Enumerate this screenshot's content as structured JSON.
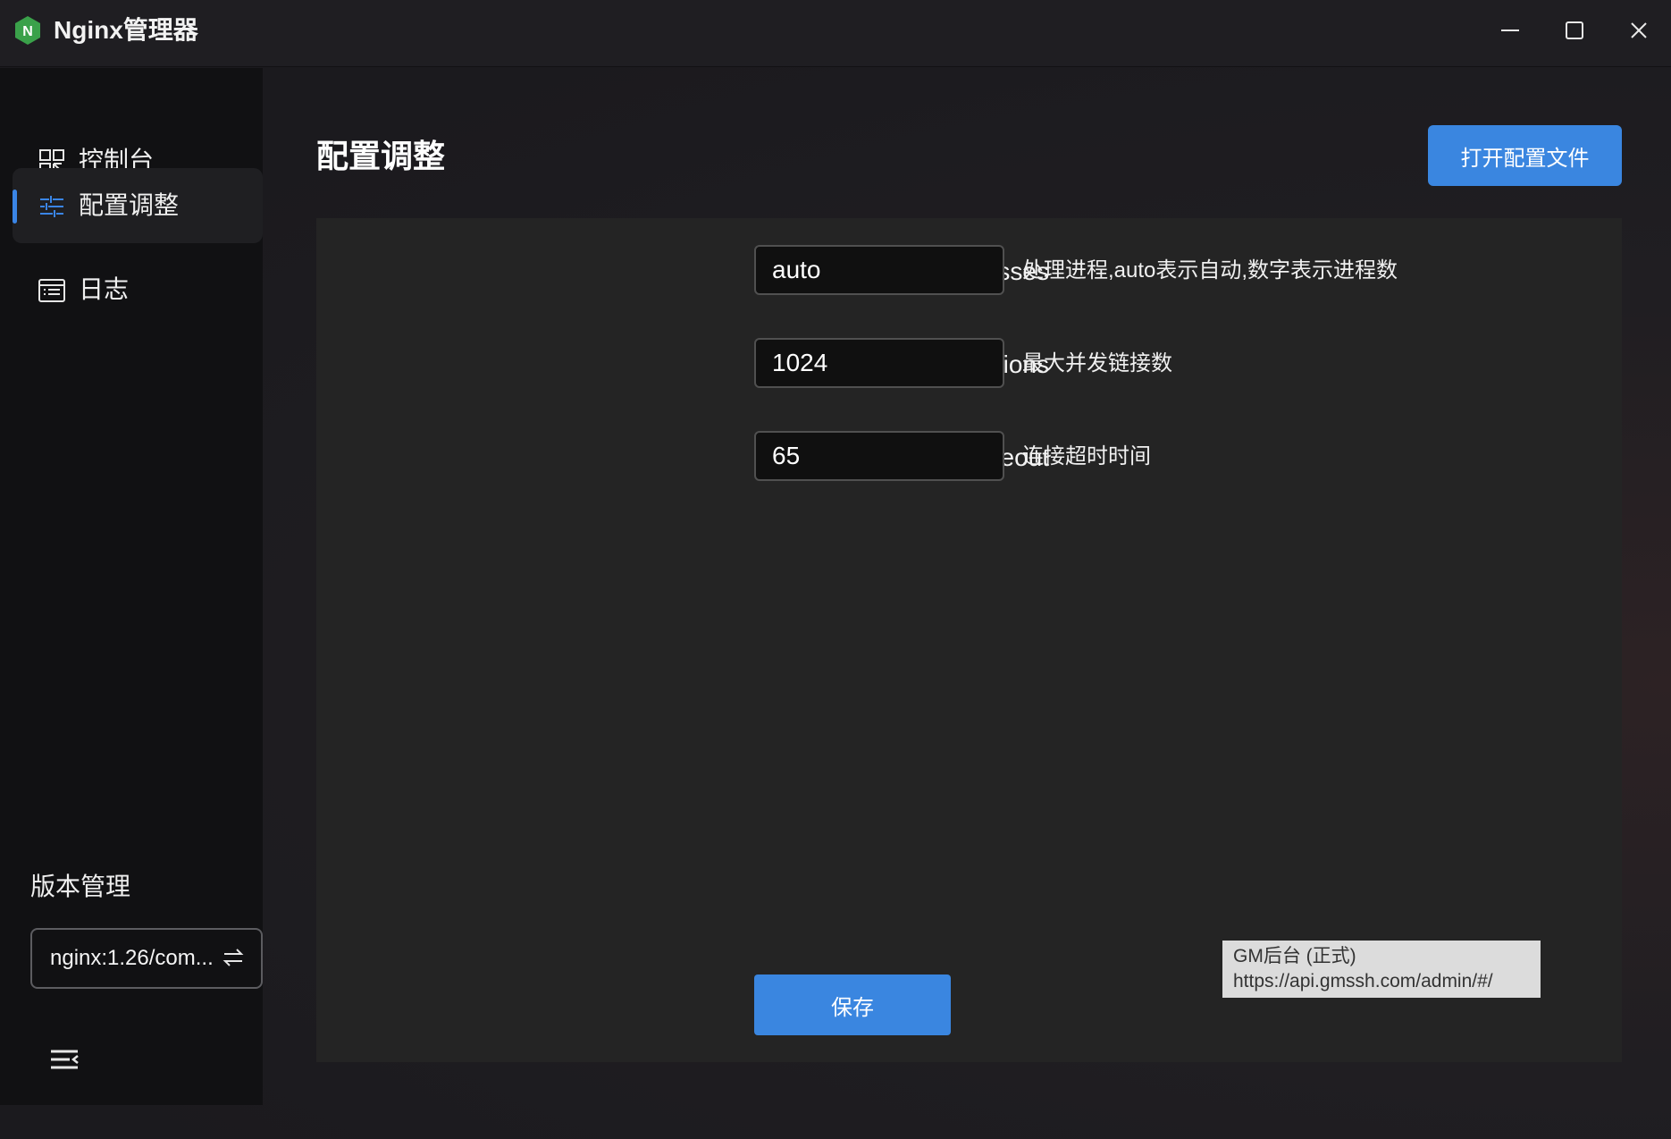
{
  "window": {
    "title": "Nginx管理器",
    "logo_letter": "N",
    "controls": [
      "minimize-icon",
      "maximize-icon",
      "close-icon"
    ]
  },
  "sidebar": {
    "items": [
      {
        "label": "控制台",
        "icon": "dashboard-grid-icon",
        "active": false
      },
      {
        "label": "配置调整",
        "icon": "sliders-icon",
        "active": true
      },
      {
        "label": "日志",
        "icon": "log-list-icon",
        "active": false
      }
    ],
    "version_section": {
      "title": "版本管理",
      "selected": "nginx:1.26/com...",
      "switch_icon": "swap-arrows-icon"
    },
    "collapse_icon": "menu-collapse-icon"
  },
  "main": {
    "title": "配置调整",
    "open_config_label": "打开配置文件",
    "fields": [
      {
        "label": "worker_processes",
        "value": "auto",
        "description": "处理进程,auto表示自动,数字表示进程数"
      },
      {
        "label": "worker_connections",
        "value": "1024",
        "description": "最大并发链接数"
      },
      {
        "label": "keepalive_timeout",
        "value": "65",
        "description": "连接超时时间"
      }
    ],
    "save_label": "保存"
  },
  "tooltip": {
    "line1": "GM后台 (正式)",
    "line2": "https://api.gmssh.com/admin/#/"
  },
  "colors": {
    "accent": "#3a86e0",
    "logo_green": "#3aa14a",
    "sidebar_bg": "#111113",
    "panel_bg": "#242424"
  }
}
